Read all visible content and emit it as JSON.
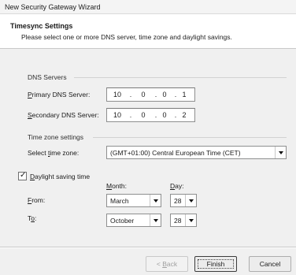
{
  "window": {
    "title": "New Security Gateway Wizard"
  },
  "header": {
    "title": "Timesync Settings",
    "subtitle": "Please select one or more DNS server, time zone and daylight savings."
  },
  "dns": {
    "group_label": "DNS Servers",
    "primary": {
      "label_accel": "P",
      "label_rest": "rimary DNS Server:",
      "octets": [
        "10",
        "0",
        "0",
        "1"
      ]
    },
    "secondary": {
      "label_accel": "S",
      "label_rest": "econdary DNS Server:",
      "octets": [
        "10",
        "0",
        "0",
        "2"
      ]
    }
  },
  "timezone": {
    "group_label": "Time zone settings",
    "select_label_pre": "Select ",
    "select_label_accel": "t",
    "select_label_post": "ime zone:",
    "selected": "(GMT+01:00) Central European Time (CET)"
  },
  "daylight": {
    "checked": true,
    "check_glyph": "✓",
    "label_accel": "D",
    "label_rest": "aylight saving time",
    "month_header_accel": "M",
    "month_header_rest": "onth:",
    "day_header_accel": "D",
    "day_header_rest": "ay:",
    "from": {
      "label_accel": "F",
      "label_rest": "rom:",
      "month": "March",
      "day": "28"
    },
    "to": {
      "label_pre": "T",
      "label_accel": "o",
      "label_post": ":",
      "month": "October",
      "day": "28"
    }
  },
  "buttons": {
    "back_prefix": "< ",
    "back_accel": "B",
    "back_rest": "ack",
    "finish": "Finish",
    "cancel": "Cancel"
  },
  "icons": {
    "dropdown": "chevron-down-icon",
    "checkbox": "check-icon"
  }
}
